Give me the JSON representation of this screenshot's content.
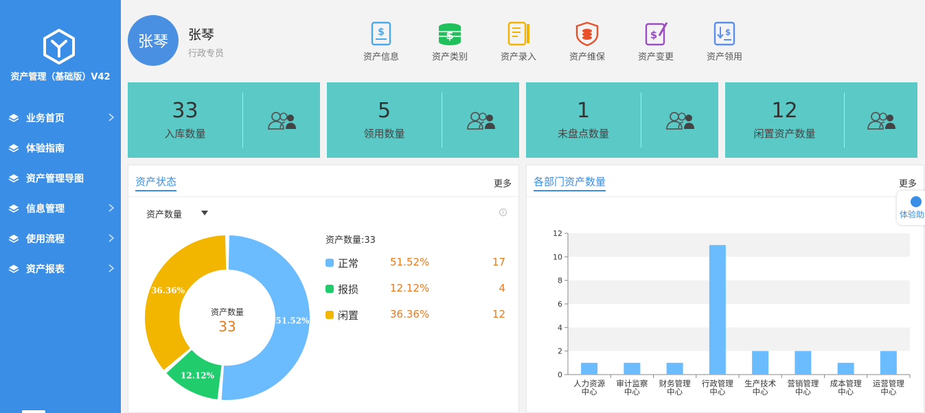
{
  "app": {
    "title": "资产管理（基础版）V42"
  },
  "sidebar": {
    "items": [
      {
        "label": "业务首页",
        "has_children": true
      },
      {
        "label": "体验指南",
        "has_children": false
      },
      {
        "label": "资产管理导图",
        "has_children": false
      },
      {
        "label": "信息管理",
        "has_children": true
      },
      {
        "label": "使用流程",
        "has_children": true
      },
      {
        "label": "资产报表",
        "has_children": true
      }
    ]
  },
  "user": {
    "avatar_text": "张琴",
    "name": "张琴",
    "role": "行政专员"
  },
  "quick_actions": [
    {
      "label": "资产信息",
      "icon": "document-dollar-icon",
      "color": "#4aa8e8"
    },
    {
      "label": "资产类别",
      "icon": "coins-stack-icon",
      "color": "#20c05c"
    },
    {
      "label": "资产录入",
      "icon": "ledger-entry-icon",
      "color": "#f0b400"
    },
    {
      "label": "资产维保",
      "icon": "shield-coins-icon",
      "color": "#e8502c"
    },
    {
      "label": "资产变更",
      "icon": "document-edit-icon",
      "color": "#9a4ec0"
    },
    {
      "label": "资产领用",
      "icon": "document-receive-icon",
      "color": "#5a8ee8"
    }
  ],
  "stats": [
    {
      "value": "33",
      "label": "入库数量"
    },
    {
      "value": "5",
      "label": "领用数量"
    },
    {
      "value": "1",
      "label": "未盘点数量"
    },
    {
      "value": "12",
      "label": "闲置资产数量"
    }
  ],
  "asset_status": {
    "title": "资产状态",
    "more": "更多",
    "selector": "资产数量",
    "info_glyph": "i",
    "center_label": "资产数量",
    "center_value": "33",
    "legend_title": "资产数量:33"
  },
  "dept_panel": {
    "title": "各部门资产数量",
    "more": "更多"
  },
  "helper": {
    "label": "体验助手"
  },
  "colors": {
    "accent": "#3a8ee6",
    "tile": "#5bc9c6",
    "orange": "#e87a1c"
  },
  "chart_data": [
    {
      "type": "pie",
      "series": [
        {
          "name": "正常",
          "value": 17,
          "percent": "51.52%",
          "color": "#6bbcff"
        },
        {
          "name": "报损",
          "value": 4,
          "percent": "12.12%",
          "color": "#20cc6c"
        },
        {
          "name": "闲置",
          "value": 12,
          "percent": "36.36%",
          "color": "#f2b500"
        }
      ]
    },
    {
      "type": "bar",
      "categories": [
        [
          "人力资源",
          "中心"
        ],
        [
          "审计监察",
          "中心"
        ],
        [
          "财务管理",
          "中心"
        ],
        [
          "行政管理",
          "中心"
        ],
        [
          "生产技术",
          "中心"
        ],
        [
          "营销管理",
          "中心"
        ],
        [
          "成本管理",
          "中心"
        ],
        [
          "运营管理",
          "中心"
        ]
      ],
      "values": [
        1,
        1,
        1,
        11,
        2,
        2,
        1,
        2
      ],
      "ylim": [
        0,
        12
      ],
      "yticks": [
        0,
        2,
        4,
        6,
        8,
        10,
        12
      ],
      "bar_color": "#6bbcff",
      "grid": "alternating-bands"
    }
  ]
}
